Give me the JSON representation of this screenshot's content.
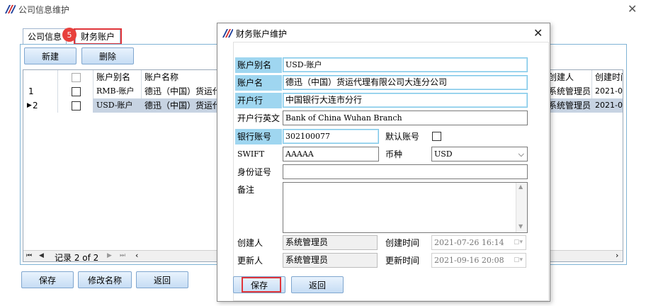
{
  "window": {
    "title": "公司信息维护"
  },
  "tabs": [
    {
      "label": "公司信息"
    },
    {
      "label": "财务账户"
    }
  ],
  "badge": "5",
  "toolbar": {
    "new_label": "新建",
    "delete_label": "删除"
  },
  "grid": {
    "headers": [
      "账户别名",
      "账户名称",
      "创建人",
      "创建时间"
    ],
    "rows": [
      {
        "index": "1",
        "marker": "",
        "alias": "RMB-账户",
        "name": "德迅（中国）货运代",
        "creator": "系统管理员",
        "time": "2021-07"
      },
      {
        "index": "2",
        "marker": "▶",
        "alias": "USD-账户",
        "name": "德迅（中国）货运代",
        "creator": "系统管理员",
        "time": "2021-07"
      }
    ],
    "pager": {
      "record_text": "记录 2 of 2"
    }
  },
  "bottom": {
    "save_label": "保存",
    "rename_label": "修改名称",
    "back_label": "返回"
  },
  "dialog": {
    "title": "财务账户维护",
    "labels": {
      "alias": "账户别名",
      "name": "账户名",
      "bank": "开户行",
      "bank_en": "开户行英文",
      "account_no": "银行账号",
      "default": "默认账号",
      "swift": "SWIFT",
      "currency": "币种",
      "id_no": "身份证号",
      "remark": "备注",
      "creator": "创建人",
      "created_time": "创建时间",
      "updater": "更新人",
      "updated_time": "更新时间"
    },
    "values": {
      "alias": "USD-账户",
      "name": "德迅（中国）货运代理有限公司大连分公司",
      "bank": "中国银行大连市分行",
      "bank_en": "Bank of China Wuhan Branch",
      "account_no": "302100077",
      "swift": "AAAAA",
      "currency": "USD",
      "id_no": "",
      "remark": "",
      "creator": "系统管理员",
      "created_time": "2021-07-26 16:14",
      "updater": "系统管理员",
      "updated_time": "2021-09-16 20:08"
    },
    "save_label": "保存",
    "back_label": "返回"
  }
}
